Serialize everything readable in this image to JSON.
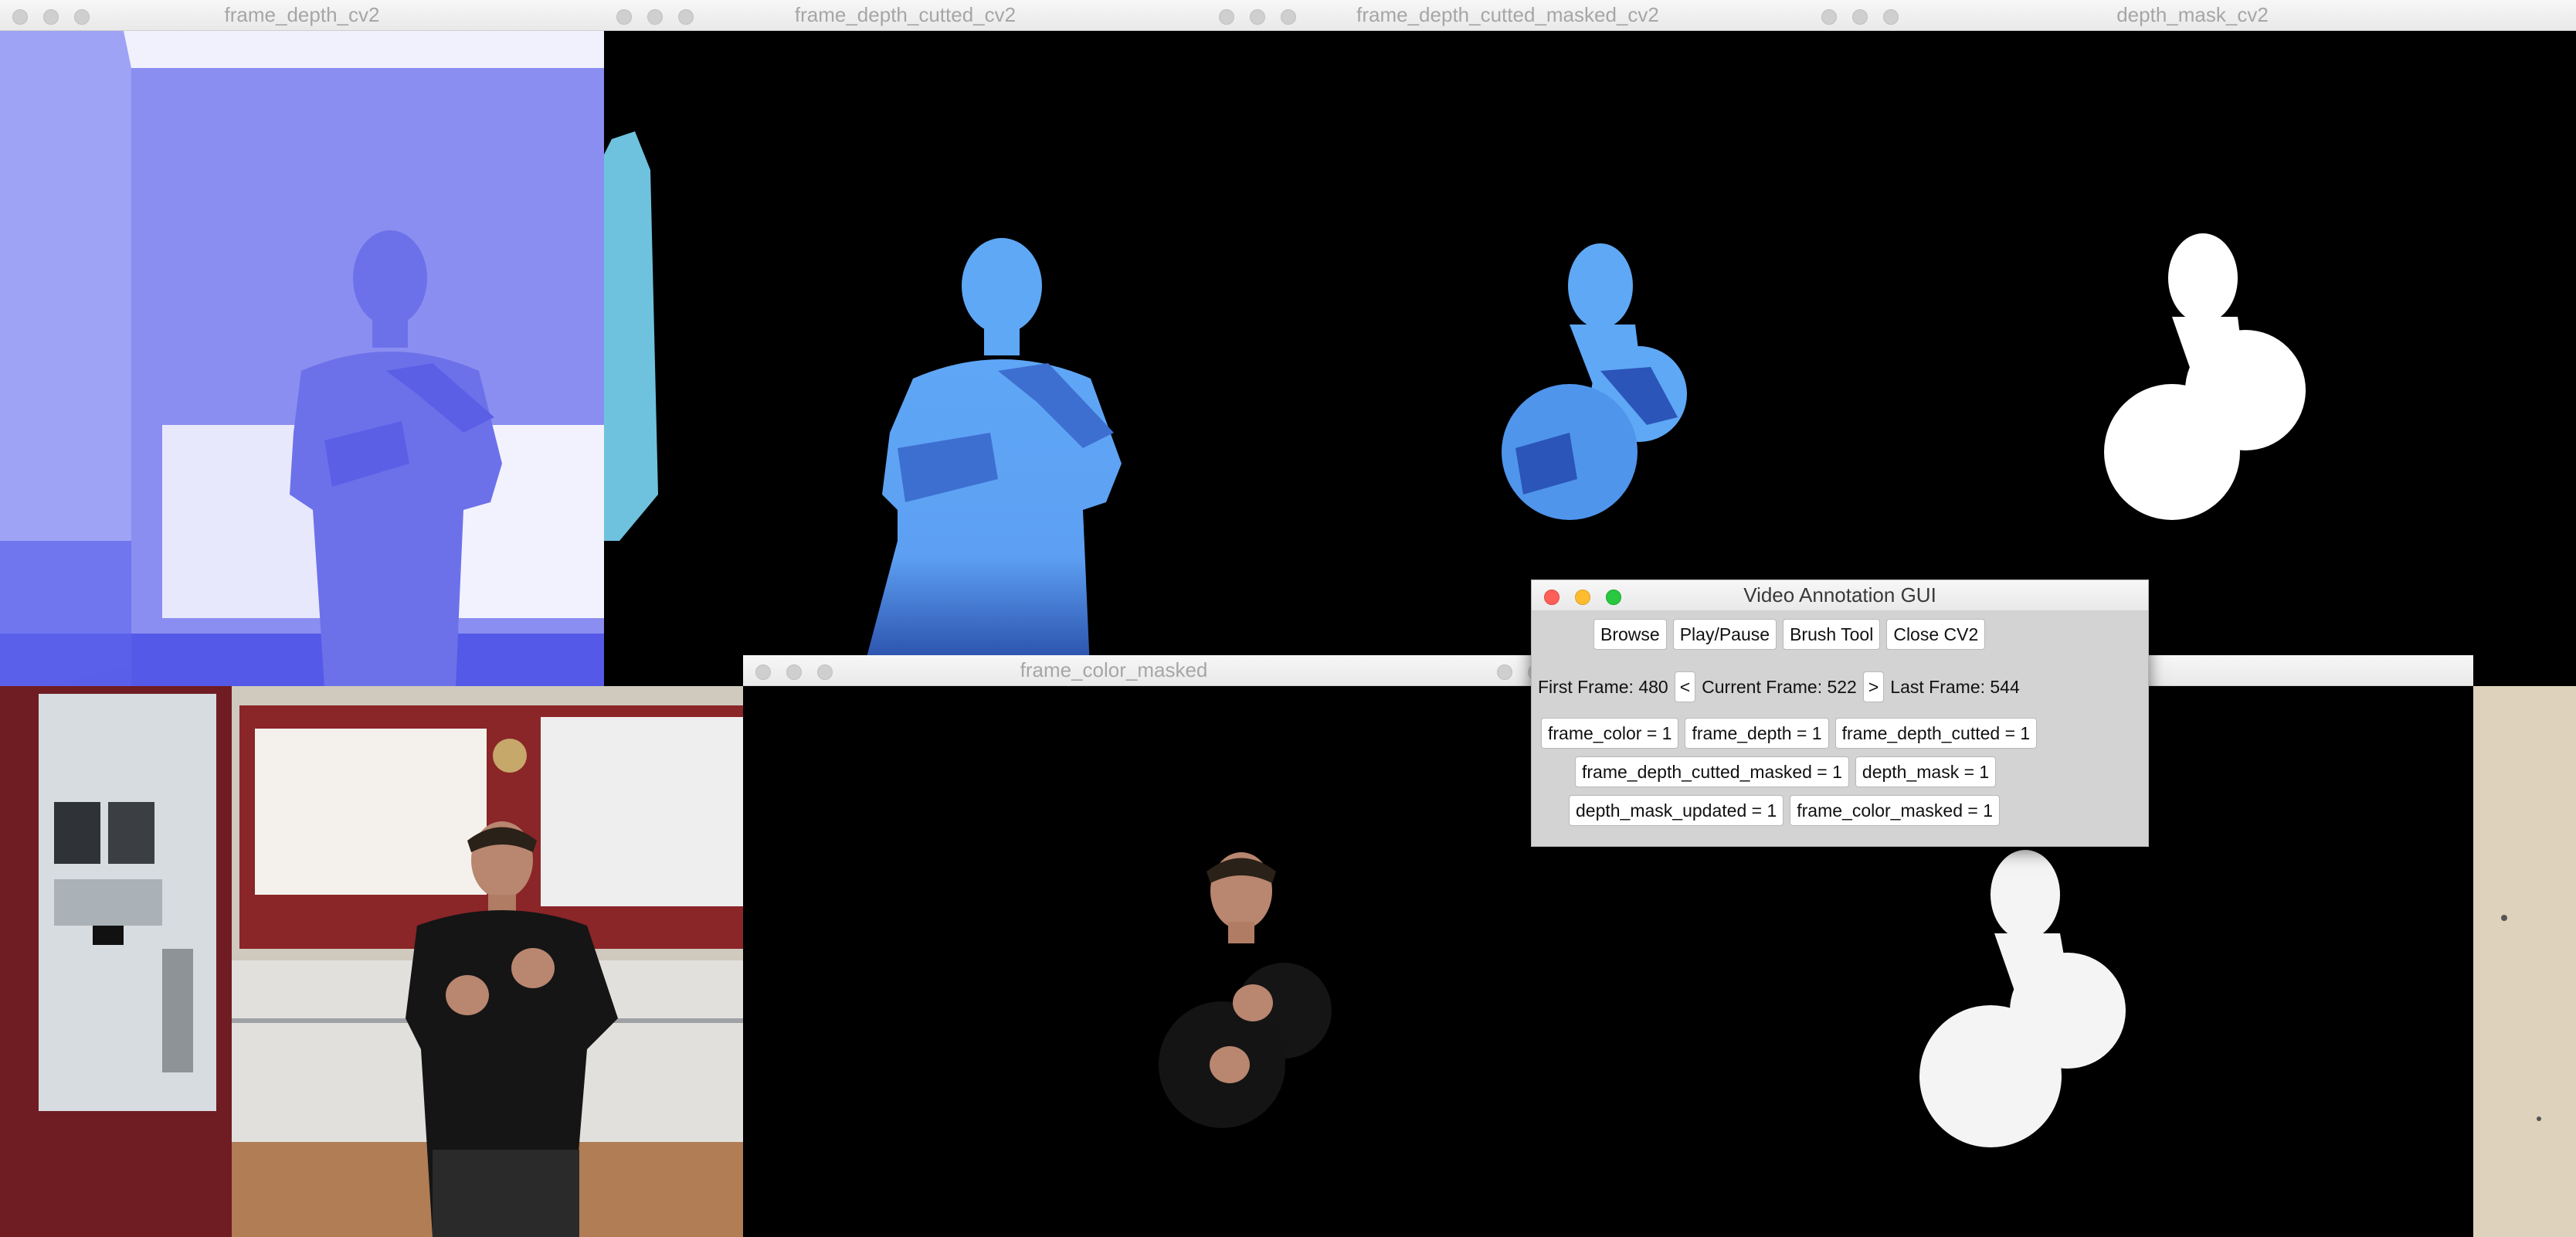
{
  "windows": {
    "frame_depth": {
      "title": "frame_depth_cv2"
    },
    "frame_depth_cutted": {
      "title": "frame_depth_cutted_cv2"
    },
    "frame_depth_cutted_masked": {
      "title": "frame_depth_cutted_masked_cv2"
    },
    "depth_mask": {
      "title": "depth_mask_cv2"
    },
    "frame_color_masked": {
      "title": "frame_color_masked"
    },
    "frame_color": {
      "title": ""
    },
    "depth_mask_updated": {
      "title": ""
    }
  },
  "gui": {
    "title": "Video Annotation GUI",
    "buttons": {
      "browse": "Browse",
      "play_pause": "Play/Pause",
      "brush_tool": "Brush Tool",
      "close_cv2": "Close CV2"
    },
    "frames": {
      "first": "First Frame: 480",
      "prev": "<",
      "current": "Current Frame: 522",
      "next": ">",
      "last": "Last Frame: 544"
    },
    "toggles": {
      "frame_color": "frame_color = 1",
      "frame_depth": "frame_depth = 1",
      "frame_depth_cutted": "frame_depth_cutted = 1",
      "frame_depth_cutted_masked": "frame_depth_cutted_masked = 1",
      "depth_mask": "depth_mask = 1",
      "depth_mask_updated": "depth_mask_updated = 1",
      "frame_color_masked": "frame_color_masked = 1"
    }
  },
  "colors": {
    "depth_bg": "#8b8ef0",
    "depth_light": "#e3e3fb",
    "depth_person": "#6f74ea",
    "cutted_blue": "#5aa2f5",
    "mask_white": "#ffffff",
    "poster_red": "#7a1f22",
    "gui_bg": "#d3d3d3"
  }
}
